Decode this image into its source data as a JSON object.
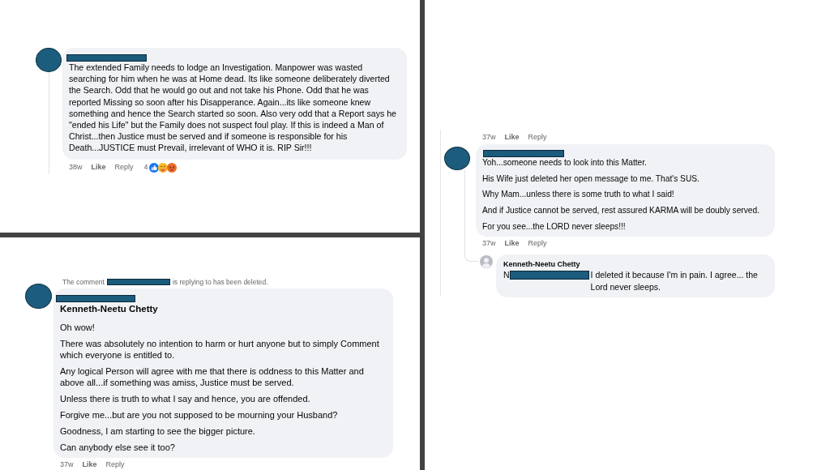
{
  "top_left_panel": {
    "comment": {
      "text": "The extended Family needs to lodge an Investigation. Manpower was wasted searching for him when he was at Home dead. Its like someone deliberately diverted the Search. Odd that he would go out and not take his Phone. Odd that he was reported Missing so soon after his Disapperance. Again...its like someone knew something and hence the Search started so soon. Also very odd that a Report says he \"ended his Life\" but the Family does not suspect foul play. If this is indeed a Man of Christ...then Justice must be served and if someone is responsible for his Death...JUSTICE must Prevail, irrelevant of WHO it is. RIP Sir!!!",
      "time": "38w",
      "actions": [
        {
          "kind": "like",
          "label": "Like"
        },
        {
          "kind": "reply",
          "label": "Reply"
        }
      ],
      "reaction_count": "4"
    }
  },
  "bottom_left_panel": {
    "deleted_notice": {
      "before_redaction": "The comment",
      "after_redaction": "is replying to has been deleted."
    },
    "comment": {
      "author": "Kenneth-Neetu Chetty",
      "paragraphs": [
        "Oh wow!",
        "There was absolutely no intention to harm or hurt anyone but to simply Comment which everyone is entitled to.",
        "Any logical Person will agree with me that there is oddness to this Matter and above all...if something was amiss, Justice must be served.",
        "Unless there is truth to what I say and hence, you are offended.",
        "Forgive me...but are you not supposed to be mourning your Husband?",
        "Goodness, I am starting to see the bigger picture.",
        "Can anybody else see it too?"
      ],
      "time": "37w",
      "actions": [
        {
          "kind": "like",
          "label": "Like"
        },
        {
          "kind": "reply",
          "label": "Reply"
        }
      ]
    }
  },
  "right_panel": {
    "earlier_comment_meta": {
      "time": "37w",
      "actions": [
        {
          "kind": "like",
          "label": "Like"
        },
        {
          "kind": "reply",
          "label": "Reply"
        }
      ]
    },
    "comment": {
      "paragraphs": [
        "Yoh...someone needs to look into this Matter.",
        "His Wife just deleted her open message to me. That's SUS.",
        "Why Mam...unless there is some truth to what I said!",
        "And if Justice cannot be served, rest assured KARMA will be doubly served.",
        "For you see...the LORD never sleeps!!!"
      ],
      "time": "37w",
      "actions": [
        {
          "kind": "like",
          "label": "Like"
        },
        {
          "kind": "reply",
          "label": "Reply"
        }
      ]
    },
    "reply": {
      "author": "Kenneth-Neetu Chetty",
      "name_start": "N",
      "text": "I deleted it because I'm in pain. I agree... the Lord never sleeps."
    }
  }
}
